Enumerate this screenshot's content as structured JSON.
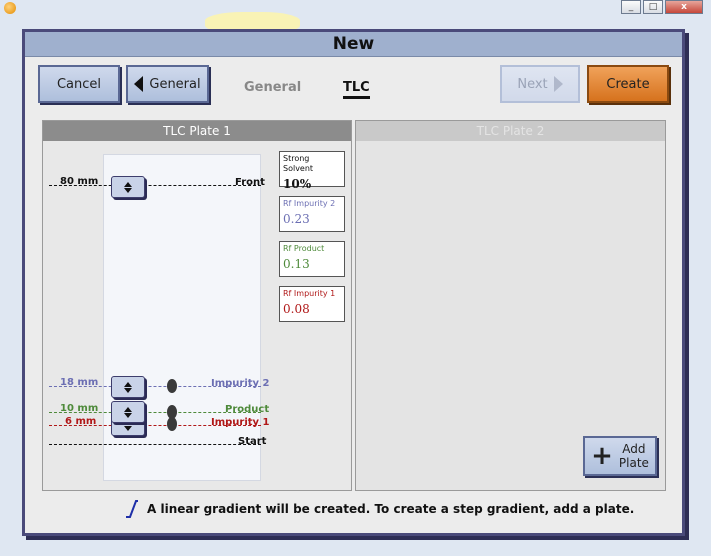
{
  "window": {
    "minimize": "_",
    "maximize": "□",
    "close": "x"
  },
  "dialog": {
    "title": "New"
  },
  "toolbar": {
    "cancel": "Cancel",
    "general": "General",
    "next": "Next",
    "create": "Create"
  },
  "tabs": {
    "general": "General",
    "tlc": "TLC"
  },
  "plate1": {
    "header": "TLC Plate 1",
    "markers": [
      {
        "mm": "80 mm",
        "label": "Front",
        "color": "#111111"
      },
      {
        "mm": "18 mm",
        "label": "Impurity 2",
        "color": "#6c6fb3"
      },
      {
        "mm": "10 mm",
        "label": "Product",
        "color": "#4e8a3a"
      },
      {
        "mm": "6 mm",
        "label": "Impurity 1",
        "color": "#b01818"
      }
    ],
    "start_label": "Start",
    "info": [
      {
        "title": "Strong Solvent",
        "value": "10%",
        "color": "#111111"
      },
      {
        "title": "Rf Impurity 2",
        "value": "0.23",
        "color": "#6c6fb3"
      },
      {
        "title": "Rf Product",
        "value": "0.13",
        "color": "#4e8a3a"
      },
      {
        "title": "Rf Impurity 1",
        "value": "0.08",
        "color": "#b01818"
      }
    ]
  },
  "plate2": {
    "header": "TLC Plate 2"
  },
  "add_plate": {
    "line1": "Add",
    "line2": "Plate"
  },
  "footer": {
    "text": "A linear gradient will be created. To create a step gradient, add a plate."
  },
  "icons": {
    "back": "triangle-left-icon",
    "next": "triangle-right-icon",
    "add": "plus-icon",
    "gradient": "linear-gradient-icon"
  }
}
